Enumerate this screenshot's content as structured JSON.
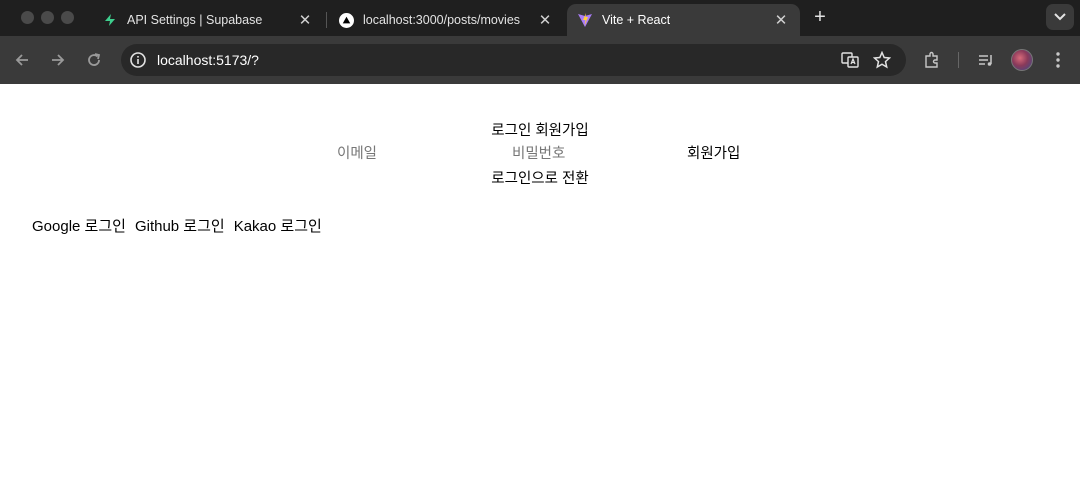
{
  "browser": {
    "tabs": [
      {
        "title": "API Settings | Supabase",
        "favicon": "supabase-icon",
        "active": false
      },
      {
        "title": "localhost:3000/posts/movies",
        "favicon": "nextjs-icon",
        "active": false
      },
      {
        "title": "Vite + React",
        "favicon": "vite-icon",
        "active": true
      }
    ],
    "new_tab_label": "+",
    "url": "localhost:5173/?"
  },
  "auth": {
    "mode_tabs": {
      "login": "로그인",
      "signup": "회원가입"
    },
    "email_placeholder": "이메일",
    "password_placeholder": "비밀번호",
    "submit_label": "회원가입",
    "switch_label": "로그인으로 전환"
  },
  "social": {
    "google": "Google 로그인",
    "github": "Github 로그인",
    "kakao": "Kakao 로그인"
  },
  "colors": {
    "tabstrip_bg": "#1f1f1f",
    "toolbar_bg": "#3a3a3a",
    "omnibox_bg": "#282828",
    "page_bg": "#ffffff"
  }
}
